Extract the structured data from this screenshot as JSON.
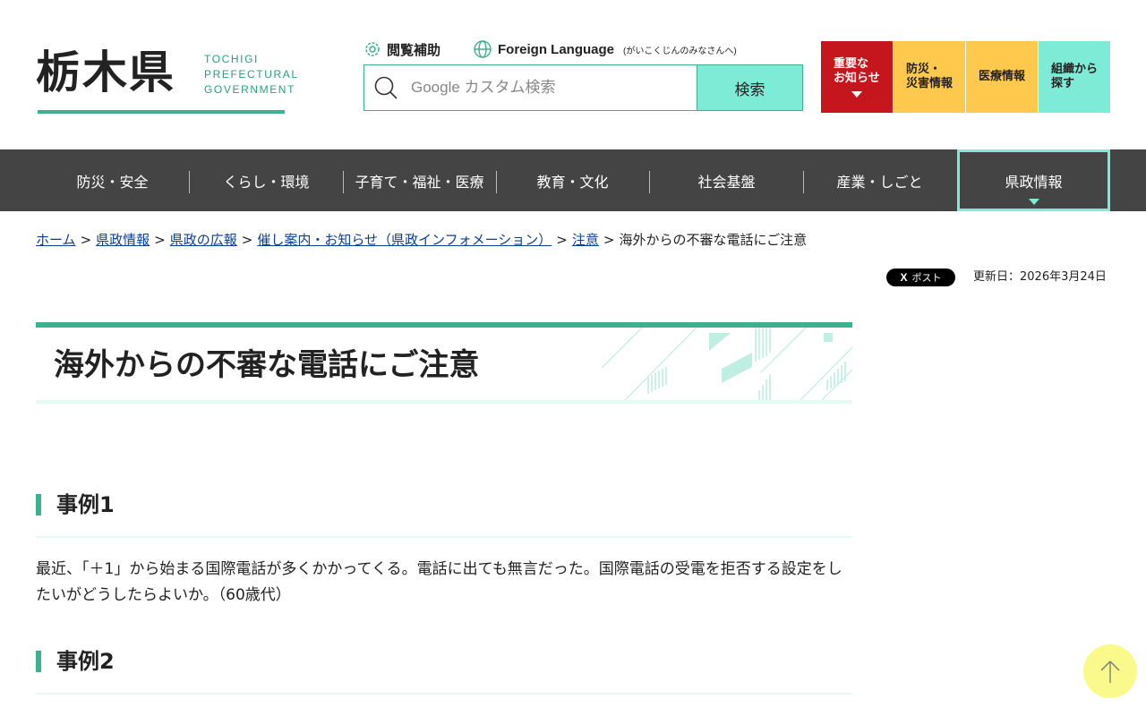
{
  "header": {
    "logo_main": "栃木県",
    "logo_sub_lines": [
      "TOCHIGI",
      "PREFECTURAL",
      "GOVERNMENT"
    ],
    "access_label": "閲覧補助",
    "lang_label": "Foreign Language",
    "lang_sub": "(がいこくじんのみなさんへ)",
    "search": {
      "placeholder": "Google カスタム検索",
      "value": "",
      "button_label": "検索"
    },
    "quick_links": {
      "important": "重要な\nお知らせ",
      "disaster": "防災・\n災害情報",
      "medical": "医療情報",
      "organization": "組織から\n探す"
    },
    "icons": {
      "access": "accessibility-gear-icon",
      "language": "globe-icon",
      "search": "search-icon"
    }
  },
  "gnav": {
    "items": [
      "防災・安全",
      "くらし・環境",
      "子育て・福祉・医療",
      "教育・文化",
      "社会基盤",
      "産業・しごと",
      "県政情報"
    ],
    "active": "県政情報"
  },
  "breadcrumb": {
    "links": [
      "ホーム",
      "県政情報",
      "県政の広報",
      "催し案内・お知らせ（県政インフォメーション）",
      "注意"
    ],
    "separator": ">",
    "current": "海外からの不審な電話にご注意"
  },
  "meta": {
    "post_label": "ポスト",
    "post_icon": "X",
    "updated": "更新日：2026年3月24日"
  },
  "page": {
    "title": "海外からの不審な電話にご注意",
    "sections": [
      {
        "heading": "事例1",
        "body": "最近、「＋1」から始まる国際電話が多くかかってくる。電話に出ても無言だった。国際電話の受電を拒否する設定をしたいがどうしたらよいか。（60歳代）"
      },
      {
        "heading": "事例2"
      }
    ]
  },
  "colors": {
    "accent_green": "#3cb08f",
    "mint": "#7eebd6",
    "nav_bg": "#444444",
    "important_red": "#c4161c",
    "yellow": "#ffc94d",
    "link_blue": "#0b3f91",
    "pagetop_yellow": "#fafa8c"
  },
  "pagetop_icon": "arrow-up-icon"
}
